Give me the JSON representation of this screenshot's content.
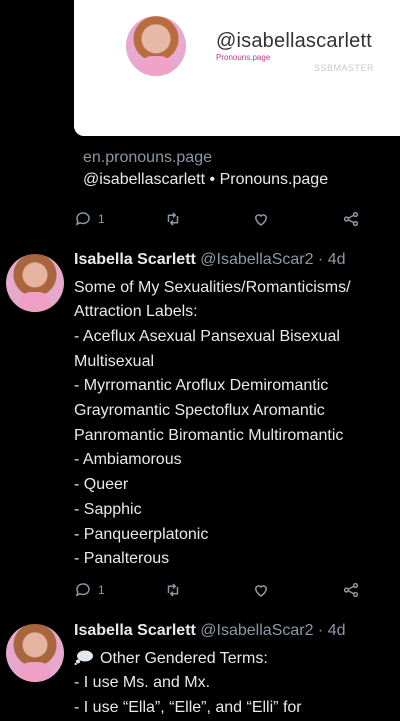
{
  "card": {
    "handle": "@isabellascarlett",
    "sub": "Pronouns.page",
    "watermark": "SSBMASTER"
  },
  "link_preview": {
    "domain": "en.pronouns.page",
    "title": "@isabellascarlett • Pronouns.page"
  },
  "tweet1_actions": {
    "reply_count": "1",
    "retweet_count": "",
    "like_count": ""
  },
  "tweet2": {
    "name": "Isabella Scarlett",
    "meta": "@IsabellaScar2 · 4d",
    "lines": [
      "Some of My Sexualities/Romanticisms/",
      "Attraction Labels:",
      "- Aceflux Asexual Pansexual Bisexual",
      "Multisexual",
      "- Myrromantic Aroflux Demiromantic",
      "Grayromantic Spectoflux Aromantic",
      "Panromantic Biromantic Multiromantic",
      "- Ambiamorous",
      "- Queer",
      "- Sapphic",
      "- Panqueerplatonic",
      "- Panalterous"
    ],
    "reply_count": "1"
  },
  "tweet3": {
    "name": "Isabella Scarlett",
    "meta": "@IsabellaScar2 · 4d",
    "lines": [
      "Other Gendered Terms:",
      "- I use Ms. and Mx.",
      "- I use “Ella”, “Elle”, and “Elli” for"
    ]
  },
  "icons": [
    "reply-icon",
    "retweet-icon",
    "like-icon",
    "share-icon",
    "thought-bubble-icon"
  ]
}
